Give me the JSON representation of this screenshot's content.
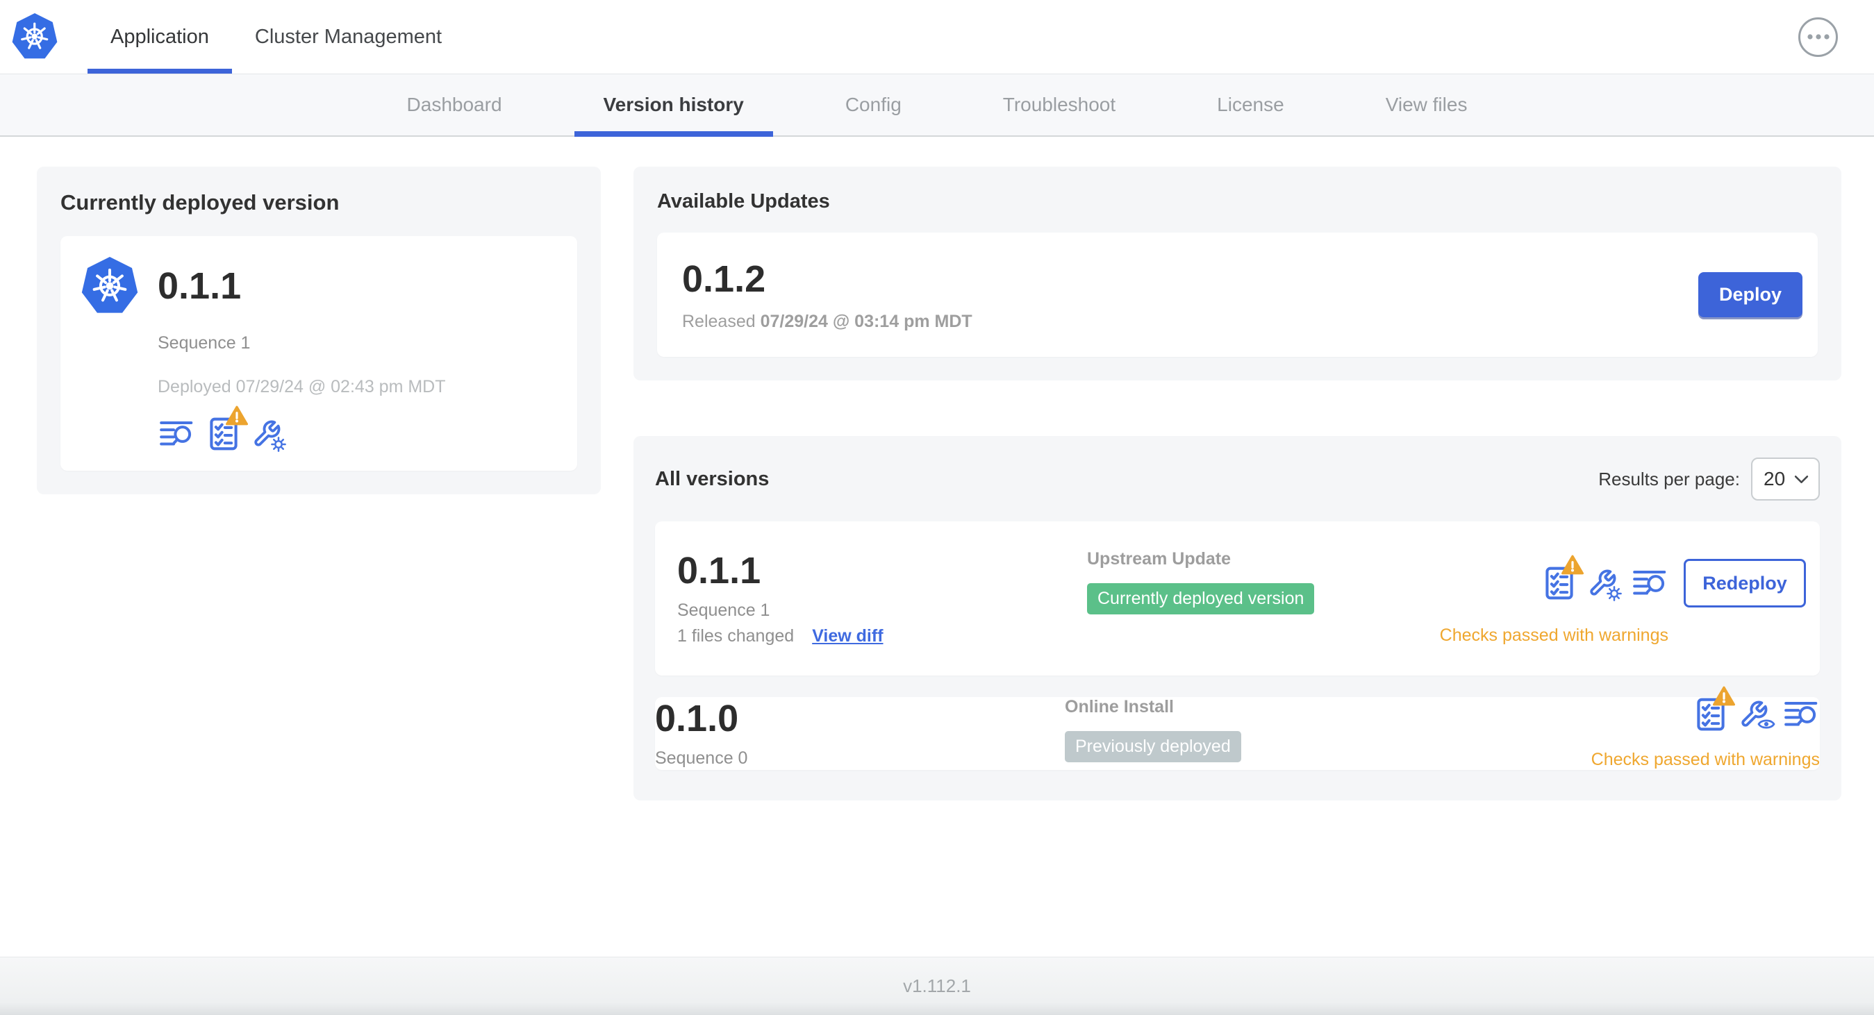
{
  "header": {
    "logo": "kubernetes-logo",
    "tabs": [
      {
        "label": "Application",
        "active": true
      },
      {
        "label": "Cluster Management",
        "active": false
      }
    ],
    "menu_icon": "ellipsis-icon"
  },
  "subnav": {
    "items": [
      {
        "label": "Dashboard",
        "active": false
      },
      {
        "label": "Version history",
        "active": true
      },
      {
        "label": "Config",
        "active": false
      },
      {
        "label": "Troubleshoot",
        "active": false
      },
      {
        "label": "License",
        "active": false
      },
      {
        "label": "View files",
        "active": false
      }
    ]
  },
  "deployed_card": {
    "title": "Currently deployed version",
    "version": "0.1.1",
    "sequence": "Sequence 1",
    "deployed_at": "Deployed 07/29/24 @ 02:43 pm MDT",
    "icons": [
      "release-diff-icon",
      "preflight-checks-warning-icon",
      "edit-config-icon"
    ]
  },
  "available_updates": {
    "title": "Available Updates",
    "version": "0.1.2",
    "released_label": "Released",
    "released_at": "07/29/24 @ 03:14 pm MDT",
    "deploy_label": "Deploy"
  },
  "all_versions": {
    "title": "All versions",
    "results_per_page_label": "Results per page:",
    "results_per_page_value": "20",
    "rows": [
      {
        "version": "0.1.1",
        "sequence": "Sequence 1",
        "files_changed": "1 files changed",
        "view_diff_label": "View diff",
        "source": "Upstream Update",
        "badge": "Currently deployed version",
        "badge_type": "green",
        "checks": "Checks passed with warnings",
        "action_label": "Redeploy",
        "icons": [
          "preflight-checks-warning-icon",
          "edit-config-icon",
          "release-diff-icon"
        ]
      },
      {
        "version": "0.1.0",
        "sequence": "Sequence 0",
        "source": "Online Install",
        "badge": "Previously deployed",
        "badge_type": "gray",
        "checks": "Checks passed with warnings",
        "icons": [
          "preflight-checks-warning-icon",
          "view-config-icon",
          "release-diff-icon"
        ]
      }
    ]
  },
  "footer": {
    "app_version": "v1.112.1"
  },
  "colors": {
    "accent_blue": "#3d64d9",
    "icon_blue": "#4573e3",
    "kubernetes_blue": "#356de4",
    "warning_amber": "#efa72f",
    "badge_green": "#5bc089",
    "badge_gray": "#bfc9cc",
    "panel_gray": "#f5f6f8"
  }
}
